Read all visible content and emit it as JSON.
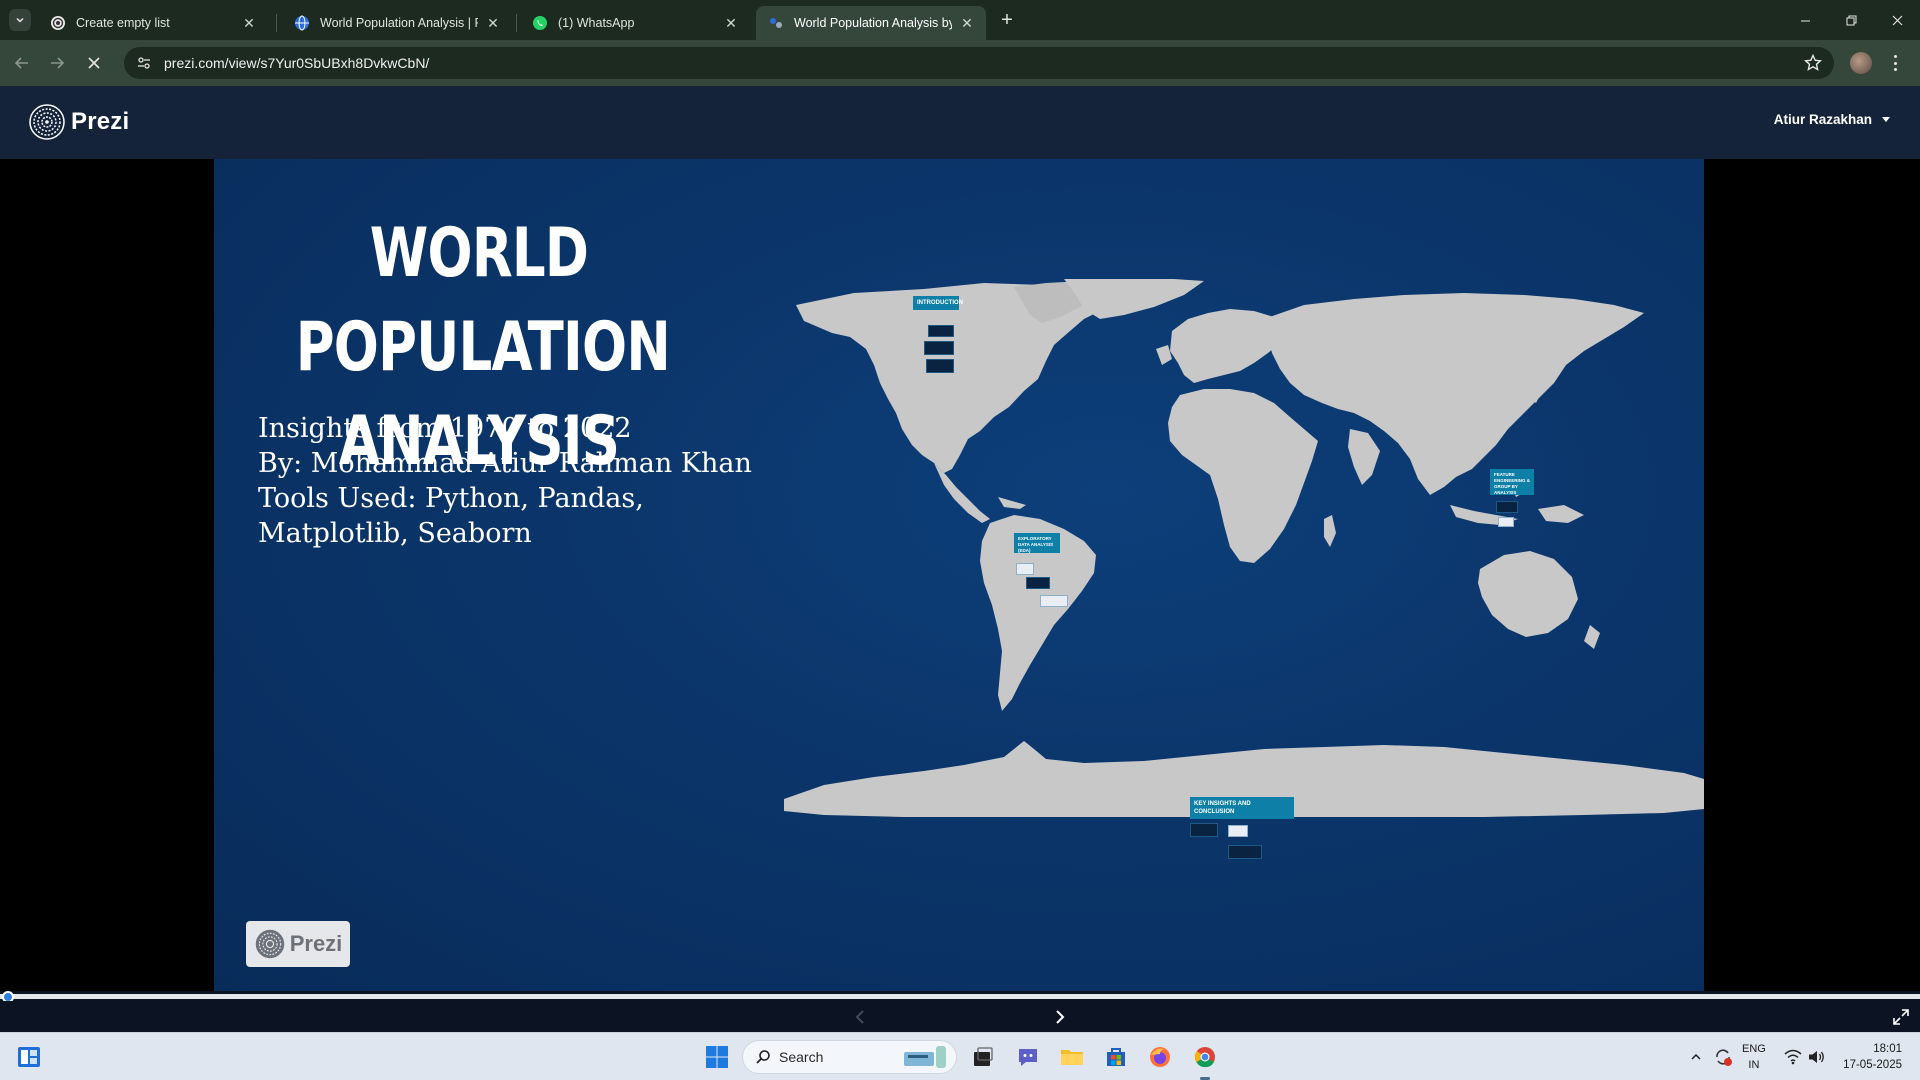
{
  "browser": {
    "tabs": [
      {
        "title": "Create empty list",
        "active": false,
        "icon": "prezi-favicon"
      },
      {
        "title": "World Population Analysis | Pre",
        "active": false,
        "icon": "globe-favicon"
      },
      {
        "title": "(1) WhatsApp",
        "active": false,
        "icon": "whatsapp-favicon"
      },
      {
        "title": "World Population Analysis by A",
        "active": true,
        "icon": "prezi-favicon"
      }
    ],
    "url": "prezi.com/view/s7Yur0SbUBxh8DvkwCbN/",
    "loading": true
  },
  "header": {
    "brand": "Prezi",
    "user_name": "Atiur Razakhan"
  },
  "slide": {
    "title_line1": "WORLD POPULATION",
    "title_line2": "ANALYSIS",
    "subtitle_lines": [
      "Insights from 1970 to 2022",
      "By: Mohammad Atiur Rahman Khan",
      "Tools Used: Python, Pandas,",
      "Matplotlib, Seaborn"
    ],
    "frames": [
      {
        "label": "INTRODUCTION"
      },
      {
        "label": "EXPLORATORY DATA ANALYSIS (EDA)"
      },
      {
        "label": "FEATURE ENGINEERING & GROUP BY ANALYSIS"
      },
      {
        "label": "KEY INSIGHTS AND CONCLUSION"
      }
    ],
    "badge": "Prezi",
    "colors": {
      "background": "#0b356a",
      "land": "#c8c8c8",
      "frame": "#0e7fa6"
    }
  },
  "player": {
    "progress_fraction": 0.0
  },
  "taskbar": {
    "search_placeholder": "Search",
    "language": "ENG",
    "region": "IN",
    "time": "18:01",
    "date": "17-05-2025"
  }
}
